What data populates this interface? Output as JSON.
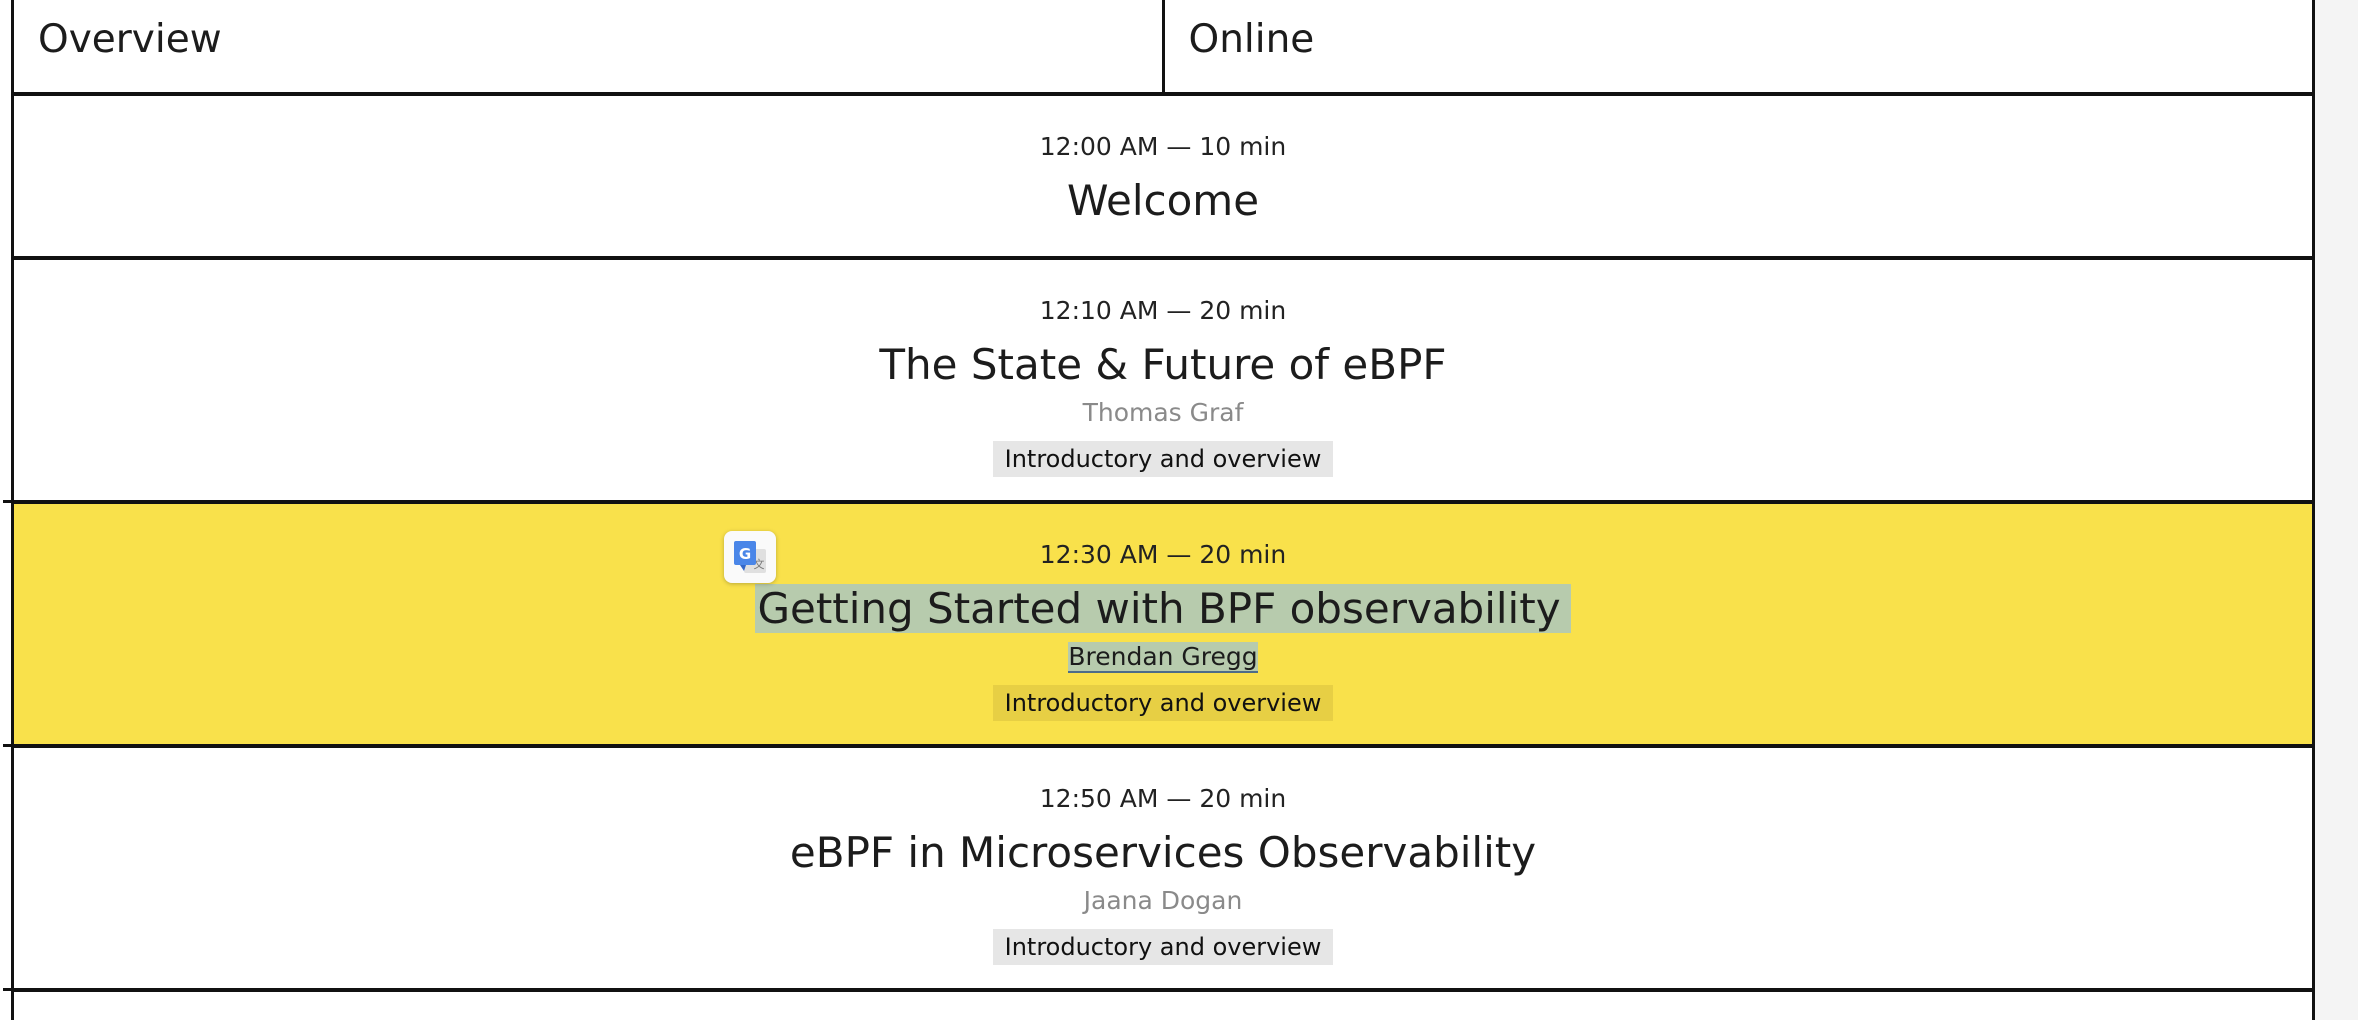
{
  "tabs": [
    {
      "label": "Overview"
    },
    {
      "label": "Online"
    }
  ],
  "sessions": [
    {
      "time": "12:00 AM — 10 min",
      "title": "Welcome",
      "speaker": "",
      "tag": ""
    },
    {
      "time": "12:10 AM — 20 min",
      "title": "The State & Future of eBPF",
      "speaker": "Thomas Graf",
      "tag": "Introductory and overview"
    },
    {
      "time": "12:30 AM — 20 min",
      "title": "Getting Started with BPF observability",
      "speaker": "Brendan Gregg",
      "tag": "Introductory and overview"
    },
    {
      "time": "12:50 AM — 20 min",
      "title": "eBPF in Microservices Observability",
      "speaker": "Jaana Dogan",
      "tag": "Introductory and overview"
    }
  ],
  "translate_popup": {
    "icon": "google-translate-icon",
    "glyph": "G"
  },
  "colors": {
    "highlight": "#f9e14b",
    "selection": "#b7cbad",
    "tag": "#e6e6e6",
    "border": "#111111"
  }
}
